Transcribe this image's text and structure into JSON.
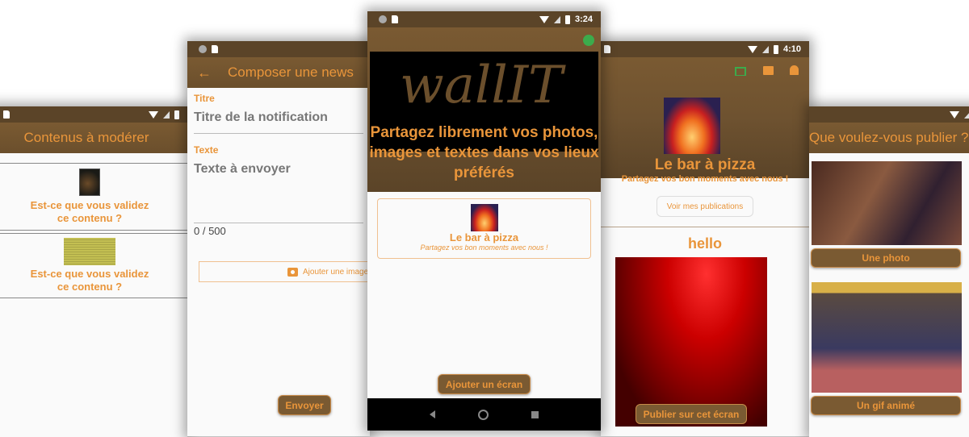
{
  "screens": {
    "moderation": {
      "title": "Contenus à modérer",
      "items": [
        {
          "question": "Est-ce que vous validez ce contenu ?",
          "thumb": "dark-photo"
        },
        {
          "question": "Est-ce que vous validez ce contenu ?",
          "thumb": "text-image"
        }
      ]
    },
    "compose": {
      "title": "Composer une news",
      "back_icon": "arrow-left-icon",
      "title_label": "Titre",
      "title_placeholder": "Titre de la notification",
      "text_label": "Texte",
      "text_placeholder": "Texte à envoyer",
      "counter": "0 / 500",
      "add_image_label": "Ajouter une image",
      "send_label": "Envoyer"
    },
    "home": {
      "status_time": "3:24",
      "logo_text": "wallIT",
      "tagline": "Partagez librement vos photos, images et textes dans vos lieux préférés",
      "place": {
        "name": "Le bar à pizza",
        "subtitle": "Partagez vos bon moments avec nous !"
      },
      "add_screen_label": "Ajouter un écran"
    },
    "place": {
      "status_time": "4:10",
      "name": "Le bar à pizza",
      "subtitle": "Partagez vos bon moments avec nous !",
      "my_posts_label": "Voir mes publications",
      "post_title": "hello",
      "publish_label": "Publier sur cet écran"
    },
    "publish": {
      "title": "Que voulez-vous publier ?",
      "photo_label": "Une photo",
      "gif_label": "Un gif animé"
    }
  },
  "colors": {
    "accent": "#e9953a",
    "brown": "#7a5a32",
    "status_bar": "#5b4428",
    "green": "#3cab4c"
  }
}
